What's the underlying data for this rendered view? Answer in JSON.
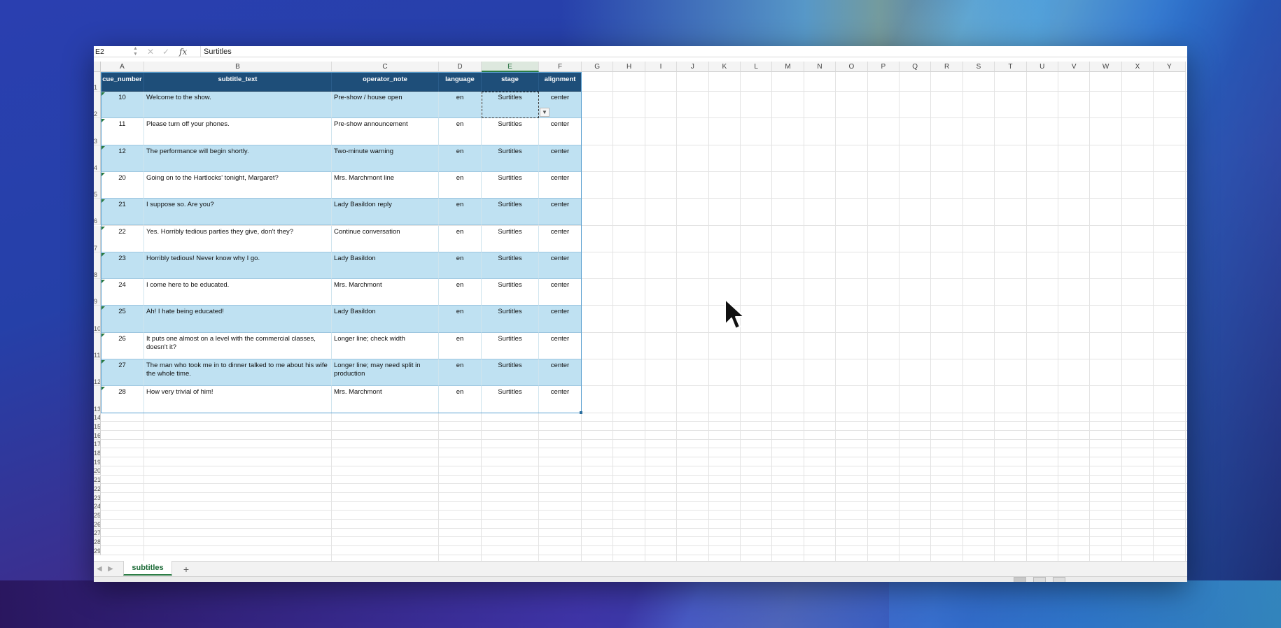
{
  "formula_bar": {
    "name_box": "E2",
    "fx_label": "fx",
    "value": "Surtitles"
  },
  "columns": [
    "A",
    "B",
    "C",
    "D",
    "E",
    "F",
    "G",
    "H",
    "I",
    "J",
    "K",
    "L",
    "M",
    "N",
    "O",
    "P",
    "Q",
    "R",
    "S",
    "T",
    "U",
    "V",
    "W",
    "X",
    "Y"
  ],
  "selected_column": "E",
  "row_numbers": [
    "1",
    "2",
    "3",
    "4",
    "5",
    "6",
    "7",
    "8",
    "9",
    "10",
    "11",
    "12",
    "13",
    "14",
    "15",
    "16",
    "17",
    "18",
    "19",
    "20",
    "21",
    "22",
    "23",
    "24",
    "25",
    "26",
    "27",
    "28",
    "29"
  ],
  "table": {
    "headers": [
      "cue_number",
      "subtitle_text",
      "operator_note",
      "language",
      "stage",
      "alignment"
    ],
    "rows": [
      {
        "cue_number": "10",
        "subtitle_text": "Welcome to the show.",
        "operator_note": "Pre-show / house open",
        "language": "en",
        "stage": "Surtitles",
        "alignment": "center"
      },
      {
        "cue_number": "11",
        "subtitle_text": "Please turn off your phones.",
        "operator_note": "Pre-show announcement",
        "language": "en",
        "stage": "Surtitles",
        "alignment": "center"
      },
      {
        "cue_number": "12",
        "subtitle_text": "The performance will begin shortly.",
        "operator_note": "Two-minute warning",
        "language": "en",
        "stage": "Surtitles",
        "alignment": "center"
      },
      {
        "cue_number": "20",
        "subtitle_text": "Going on to the Hartlocks' tonight, Margaret?",
        "operator_note": "Mrs. Marchmont line",
        "language": "en",
        "stage": "Surtitles",
        "alignment": "center"
      },
      {
        "cue_number": "21",
        "subtitle_text": "I suppose so. Are you?",
        "operator_note": "Lady Basildon reply",
        "language": "en",
        "stage": "Surtitles",
        "alignment": "center"
      },
      {
        "cue_number": "22",
        "subtitle_text": "Yes. Horribly tedious parties they give, don't they?",
        "operator_note": "Continue conversation",
        "language": "en",
        "stage": "Surtitles",
        "alignment": "center"
      },
      {
        "cue_number": "23",
        "subtitle_text": "Horribly tedious! Never know why I go.",
        "operator_note": "Lady Basildon",
        "language": "en",
        "stage": "Surtitles",
        "alignment": "center"
      },
      {
        "cue_number": "24",
        "subtitle_text": "I come here to be educated.",
        "operator_note": "Mrs. Marchmont",
        "language": "en",
        "stage": "Surtitles",
        "alignment": "center"
      },
      {
        "cue_number": "25",
        "subtitle_text": "Ah! I hate being educated!",
        "operator_note": "Lady Basildon",
        "language": "en",
        "stage": "Surtitles",
        "alignment": "center"
      },
      {
        "cue_number": "26",
        "subtitle_text": "It puts one almost on a level with the commercial classes, doesn't it?",
        "operator_note": "Longer line; check width",
        "language": "en",
        "stage": "Surtitles",
        "alignment": "center"
      },
      {
        "cue_number": "27",
        "subtitle_text": "The man who took me in to dinner talked to me about his wife the whole time.",
        "operator_note": "Longer line; may need split in production",
        "language": "en",
        "stage": "Surtitles",
        "alignment": "center"
      },
      {
        "cue_number": "28",
        "subtitle_text": "How very trivial of him!",
        "operator_note": "Mrs. Marchmont",
        "language": "en",
        "stage": "Surtitles",
        "alignment": "center"
      }
    ]
  },
  "sheet_tabs": {
    "active": "subtitles",
    "add_label": "+"
  },
  "colors": {
    "header_fill": "#1e4e79",
    "band_fill": "#bfe1f2",
    "accent": "#2d7d46"
  }
}
